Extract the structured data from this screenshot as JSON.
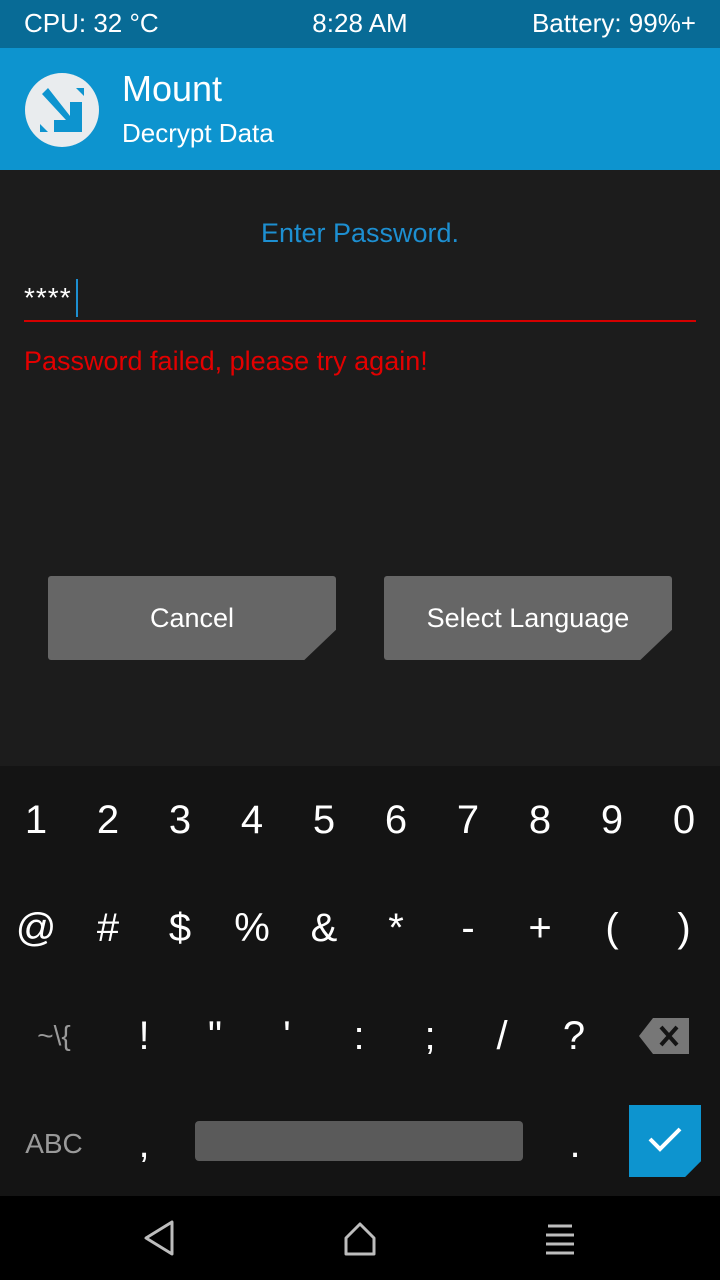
{
  "status_bar": {
    "cpu": "CPU: 32 °C",
    "time": "8:28 AM",
    "battery": "Battery: 99%+"
  },
  "header": {
    "title": "Mount",
    "subtitle": "Decrypt Data",
    "logo_icon": "twrp-logo-icon"
  },
  "main": {
    "prompt": "Enter Password.",
    "password_value": "****",
    "error": "Password failed, please try again!",
    "cancel_label": "Cancel",
    "language_label": "Select Language"
  },
  "keyboard": {
    "row1": [
      "1",
      "2",
      "3",
      "4",
      "5",
      "6",
      "7",
      "8",
      "9",
      "0"
    ],
    "row2": [
      "@",
      "#",
      "$",
      "%",
      "&",
      "*",
      "-",
      "+",
      "(",
      ")"
    ],
    "row3": [
      "~\\{",
      "!",
      "\"",
      "'",
      ":",
      ";",
      "/",
      "?"
    ],
    "mode_key": "ABC",
    "comma_key": ",",
    "period_key": ".",
    "backspace_icon": "backspace-icon",
    "enter_icon": "checkmark-icon"
  },
  "nav_bar": {
    "back_icon": "back-triangle-icon",
    "home_icon": "home-icon",
    "menu_icon": "menu-icon"
  },
  "colors": {
    "status_bar": "#086b96",
    "title_bar": "#0d94cf",
    "accent": "#1d8fd1",
    "error": "#e30000"
  }
}
